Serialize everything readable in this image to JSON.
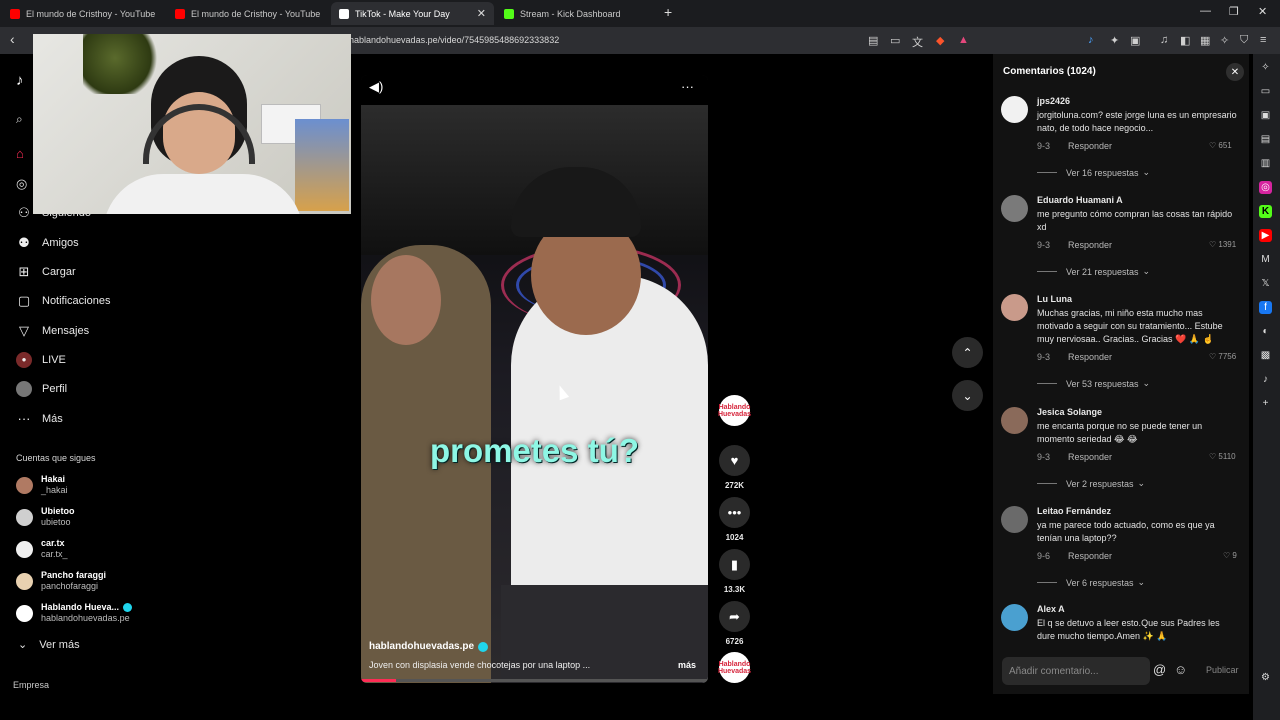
{
  "browser": {
    "tabs": [
      {
        "title": "El mundo de Cristhoy - YouTube",
        "favicon": "youtube-icon",
        "color": "#ff0000"
      },
      {
        "title": "El mundo de Cristhoy - YouTube",
        "favicon": "youtube-icon",
        "color": "#ff0000"
      },
      {
        "title": "TikTok - Make Your Day",
        "favicon": "tiktok-icon",
        "color": "#ffffff"
      },
      {
        "title": "Stream - Kick Dashboard",
        "favicon": "kick-icon",
        "color": "#53fc18"
      }
    ],
    "url": "hablandohuevadas.pe/video/7545985488692333832"
  },
  "nav": {
    "items": [
      {
        "label": "Siguiendo",
        "icon": "following-icon"
      },
      {
        "label": "Amigos",
        "icon": "friends-icon"
      },
      {
        "label": "Cargar",
        "icon": "upload-icon"
      },
      {
        "label": "Notificaciones",
        "icon": "notifications-icon"
      },
      {
        "label": "Mensajes",
        "icon": "messages-icon"
      },
      {
        "label": "LIVE",
        "icon": "live-icon"
      },
      {
        "label": "Perfil",
        "icon": "profile-icon"
      },
      {
        "label": "Más",
        "icon": "more-icon"
      }
    ],
    "following_title": "Cuentas que sigues",
    "accounts": [
      {
        "name": "Hakai",
        "handle": "_hakai"
      },
      {
        "name": "Ubietoo",
        "handle": "ubietoo"
      },
      {
        "name": "car.tx",
        "handle": "car.tx_"
      },
      {
        "name": "Pancho faraggi",
        "handle": "panchofaraggi"
      },
      {
        "name": "Hablando Hueva...",
        "handle": "hablandohuevadas.pe"
      }
    ],
    "see_more": "Ver más",
    "empresa": "Empresa"
  },
  "video": {
    "overlay_caption": "prometes tú?",
    "author": "hablandohuevadas.pe",
    "description": "Joven con displasia vende chocotejas por una laptop ...",
    "more": "más",
    "progress": 0.1,
    "logo_text": "Hablando Huevadas"
  },
  "actions": {
    "likes": "272K",
    "comments": "1024",
    "saves": "13.3K",
    "shares": "6726"
  },
  "comments": {
    "title": "Comentarios (1024)",
    "list": [
      {
        "user": "jps2426",
        "text": "jorgitoluna.com? este jorge luna es un empresario nato, de todo hace negocio...",
        "date": "9-3",
        "reply": "Responder",
        "likes": "651",
        "more": "Ver 16 respuestas",
        "avatar_color": "#f1f1f1"
      },
      {
        "user": "Eduardo Huamani A",
        "text": "me pregunto cómo compran las cosas tan rápido xd",
        "date": "9-3",
        "reply": "Responder",
        "likes": "1391",
        "more": "Ver 21 respuestas",
        "avatar_color": "#7a7a7a"
      },
      {
        "user": "Lu Luna",
        "text": "Muchas gracias, mi niño esta mucho mas motivado a seguir con su tratamiento... Estube muy nerviosaa.. Gracias.. Gracias ❤️ 🙏 ☝️",
        "date": "9-3",
        "reply": "Responder",
        "likes": "7756",
        "more": "Ver 53 respuestas",
        "avatar_color": "#c99a8a"
      },
      {
        "user": "Jesica Solange",
        "text": "me encanta porque no se puede tener un momento seriedad 😂 😂",
        "date": "9-3",
        "reply": "Responder",
        "likes": "5110",
        "more": "Ver 2 respuestas",
        "avatar_color": "#8a6a5a"
      },
      {
        "user": "Leitao Fernández",
        "text": "ya me parece todo actuado, como es que ya tenían una laptop??",
        "date": "9-6",
        "reply": "Responder",
        "likes": "9",
        "more": "Ver 6 respuestas",
        "avatar_color": "#6a6a6a"
      },
      {
        "user": "Alex A",
        "text": "El q se detuvo a leer esto.Que sus Padres les dure mucho tiempo.Amen ✨ 🙏",
        "avatar_color": "#4aa0d0"
      }
    ],
    "placeholder": "Añadir comentario...",
    "publish": "Publicar"
  }
}
